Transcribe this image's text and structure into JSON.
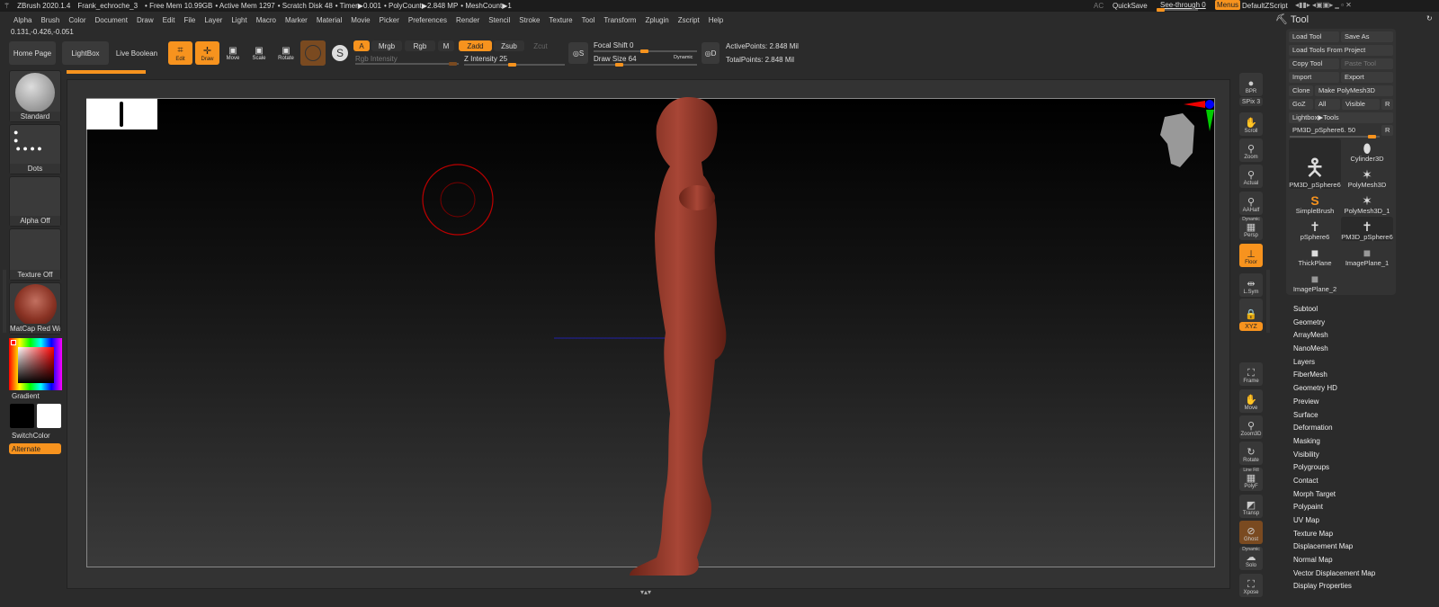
{
  "titlebar": {
    "app": "ZBrush 2020.1.4",
    "doc": "Frank_echroche_3",
    "free_mem": "• Free Mem 10.99GB",
    "active_mem": "• Active Mem 1297",
    "scratch": "• Scratch Disk 48",
    "timer": "• Timer▶0.001",
    "polycount": "• PolyCount▶2.848 MP",
    "meshcount": "• MeshCount▶1",
    "ac": "AC",
    "quicksave": "QuickSave",
    "see_through": "See-through  0",
    "see_through_value": 0,
    "menus": "Menus",
    "script": "DefaultZScript"
  },
  "menubar": [
    "Alpha",
    "Brush",
    "Color",
    "Document",
    "Draw",
    "Edit",
    "File",
    "Layer",
    "Light",
    "Macro",
    "Marker",
    "Material",
    "Movie",
    "Picker",
    "Preferences",
    "Render",
    "Stencil",
    "Stroke",
    "Texture",
    "Tool",
    "Transform",
    "Zplugin",
    "Zscript",
    "Help"
  ],
  "coords": "0.131,-0.426,-0.051",
  "toolbar": {
    "home": "Home Page",
    "lightbox": "LightBox",
    "live_boolean": "Live Boolean",
    "edit": "Edit",
    "draw": "Draw",
    "move": "Move",
    "scale": "Scale",
    "rotate": "Rotate",
    "a": "A",
    "mrgb": "Mrgb",
    "rgb": "Rgb",
    "m": "M",
    "zadd": "Zadd",
    "zsub": "Zsub",
    "zcut": "Zcut",
    "rgb_intensity": "Rgb Intensity",
    "z_intensity": "Z Intensity 25",
    "focal_shift": "Focal Shift 0",
    "draw_size": "Draw Size 64",
    "dynamic": "Dynamic",
    "active_points": "ActivePoints: 2.848 Mil",
    "total_points": "TotalPoints: 2.848 Mil",
    "s": "S",
    "d": "D"
  },
  "left": {
    "brush": "Standard",
    "stroke": "Dots",
    "alpha": "Alpha Off",
    "texture": "Texture Off",
    "material": "MatCap Red Wax",
    "gradient": "Gradient",
    "switch": "SwitchColor",
    "alternate": "Alternate",
    "colors": {
      "main": "#000000",
      "secondary": "#ffffff",
      "material": "#8a3324"
    }
  },
  "shelf": [
    {
      "label": "BPR",
      "icon": "sphere-icon"
    },
    {
      "label": "SPix 3"
    },
    {
      "label": "Scroll",
      "icon": "hand-icon"
    },
    {
      "label": "Zoom",
      "icon": "zoom-icon"
    },
    {
      "label": "Actual",
      "icon": "zoom-icon"
    },
    {
      "label": "AAHalf",
      "icon": "zoom-icon"
    },
    {
      "label": "Persp",
      "top": "Dynamic",
      "icon": "grid-icon"
    },
    {
      "label": "Floor",
      "icon": "floor-icon"
    },
    {
      "label": "L.Sym",
      "icon": "sym-icon"
    },
    {
      "label": "",
      "icon": "lock-icon"
    },
    {
      "label": "XYZ"
    },
    {
      "label": "Frame",
      "icon": "frame-icon"
    },
    {
      "label": "Move",
      "icon": "hand-icon"
    },
    {
      "label": "Zoom3D",
      "icon": "zoom-icon"
    },
    {
      "label": "Rotate",
      "icon": "rotate-icon"
    },
    {
      "label": "PolyF",
      "top": "Line Fill",
      "icon": "grid-icon"
    },
    {
      "label": "Transp",
      "icon": "transp-icon"
    },
    {
      "label": "Ghost",
      "icon": "ghost-icon"
    },
    {
      "label": "Solo",
      "top": "Dynamic",
      "icon": "solo-icon"
    },
    {
      "label": "Xpose",
      "icon": "frame-icon"
    }
  ],
  "tool": {
    "title": "Tool",
    "load": "Load Tool",
    "save_as": "Save As",
    "load_project": "Load Tools From Project",
    "copy": "Copy Tool",
    "paste": "Paste Tool",
    "import": "Import",
    "export": "Export",
    "clone": "Clone",
    "make_poly": "Make PolyMesh3D",
    "goz": "GoZ",
    "all": "All",
    "visible": "Visible",
    "r": "R",
    "lightbox_tools": "Lightbox▶Tools",
    "current": "PM3D_pSphere6. 50",
    "current_value": 50,
    "thumbs": [
      "PM3D_pSphere6",
      "Cylinder3D",
      "PolyMesh3D",
      "SimpleBrush",
      "PolyMesh3D_1",
      "pSphere6",
      "PM3D_pSphere6",
      "ThickPlane",
      "ImagePlane_1",
      "ImagePlane_2"
    ],
    "sections": [
      "Subtool",
      "Geometry",
      "ArrayMesh",
      "NanoMesh",
      "Layers",
      "FiberMesh",
      "Geometry HD",
      "Preview",
      "Surface",
      "Deformation",
      "Masking",
      "Visibility",
      "Polygroups",
      "Contact",
      "Morph Target",
      "Polypaint",
      "UV Map",
      "Texture Map",
      "Displacement Map",
      "Normal Map",
      "Vector Displacement Map",
      "Display Properties"
    ]
  },
  "accent": "#f7931e"
}
